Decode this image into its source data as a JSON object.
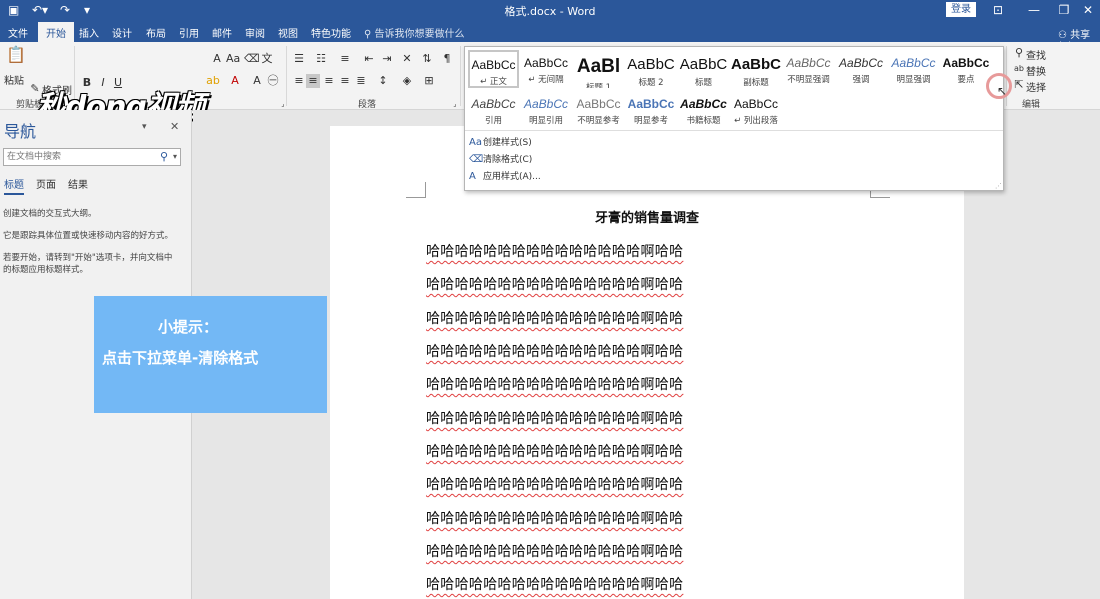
{
  "titlebar": {
    "title": "格式.docx - Word",
    "login_label": "登录",
    "save_icon": "save-icon",
    "undo_icon": "undo-icon",
    "redo_icon": "redo-icon",
    "customize_icon": "customize-icon",
    "ribbon_display_icon": "ribbon-display-icon",
    "minimize_icon": "minimize-icon",
    "restore_icon": "restore-icon",
    "close_icon": "close-icon"
  },
  "tabs": {
    "file": "文件",
    "home": "开始",
    "insert": "插入",
    "design": "设计",
    "layout": "布局",
    "references": "引用",
    "mailings": "邮件",
    "review": "审阅",
    "view": "视图",
    "special": "特色功能",
    "tellme": "告诉我你想要做什么",
    "share": "共享(S)"
  },
  "ribbon": {
    "paste_label": "粘贴",
    "format_painter_label": "格式刷",
    "clipboard_group": "剪贴板",
    "font_group": "字体",
    "paragraph_group": "段落",
    "editing_group": "编辑",
    "find_label": "查找",
    "replace_label": "替换",
    "select_label": "选择",
    "watermark": "秒dong视频"
  },
  "styles_gallery": {
    "row1": [
      {
        "sample": "AaBbCc",
        "name": "↵ 正文",
        "size": "12px",
        "weight": "normal",
        "style": "normal",
        "color": "#111111"
      },
      {
        "sample": "AaBbCc",
        "name": "↵ 无间隔",
        "size": "12px",
        "weight": "normal",
        "style": "normal",
        "color": "#111111"
      },
      {
        "sample": "AaBl",
        "name": "标题 1",
        "size": "19px",
        "weight": "bold",
        "style": "normal",
        "color": "#111111"
      },
      {
        "sample": "AaBbC",
        "name": "标题 2",
        "size": "15px",
        "weight": "normal",
        "style": "normal",
        "color": "#111111"
      },
      {
        "sample": "AaBbC",
        "name": "标题",
        "size": "15px",
        "weight": "normal",
        "style": "normal",
        "color": "#111111"
      },
      {
        "sample": "AaBbC",
        "name": "副标题",
        "size": "15px",
        "weight": "bold",
        "style": "normal",
        "color": "#111111"
      },
      {
        "sample": "AaBbCc",
        "name": "不明显强调",
        "size": "12px",
        "weight": "normal",
        "style": "italic",
        "color": "#666666"
      },
      {
        "sample": "AaBbCc",
        "name": "强调",
        "size": "12px",
        "weight": "normal",
        "style": "italic",
        "color": "#333333"
      },
      {
        "sample": "AaBbCc",
        "name": "明显强调",
        "size": "12px",
        "weight": "normal",
        "style": "italic",
        "color": "#4a74b5"
      },
      {
        "sample": "AaBbCc",
        "name": "要点",
        "size": "12px",
        "weight": "bold",
        "style": "normal",
        "color": "#111111"
      }
    ],
    "row2": [
      {
        "sample": "AaBbCc",
        "name": "引用",
        "size": "12px",
        "weight": "normal",
        "style": "italic",
        "color": "#444444"
      },
      {
        "sample": "AaBbCc",
        "name": "明显引用",
        "size": "12px",
        "weight": "normal",
        "style": "italic",
        "color": "#4a74b5"
      },
      {
        "sample": "AaBbCc",
        "name": "不明显参考",
        "size": "12px",
        "weight": "normal",
        "style": "normal",
        "color": "#777777"
      },
      {
        "sample": "AaBbCc",
        "name": "明显参考",
        "size": "12px",
        "weight": "bold",
        "style": "normal",
        "color": "#4a74b5"
      },
      {
        "sample": "AaBbCc",
        "name": "书籍标题",
        "size": "12px",
        "weight": "bold",
        "style": "italic",
        "color": "#111111"
      },
      {
        "sample": "AaBbCc",
        "name": "↵ 列出段落",
        "size": "12px",
        "weight": "normal",
        "style": "normal",
        "color": "#111111"
      }
    ],
    "actions": {
      "create": "创建样式(S)",
      "clear": "清除格式(C)",
      "apply": "应用样式(A)..."
    }
  },
  "navpane": {
    "title": "导航",
    "search_placeholder": "在文档中搜索",
    "tabs": [
      "标题",
      "页面",
      "结果"
    ],
    "lines": [
      "创建文档的交互式大纲。",
      "它是跟踪具体位置或快速移动内容的好方式。",
      "若要开始，请转到\"开始\"选项卡，并向文档中",
      "的标题应用标题样式。"
    ]
  },
  "tip": {
    "title": "小提示：",
    "body": "点击下拉菜单-清除格式"
  },
  "document": {
    "heading": "牙膏的销售量调查",
    "lines": [
      "哈哈哈哈哈哈哈哈哈哈哈哈哈哈哈啊哈哈",
      "哈哈哈哈哈哈哈哈哈哈哈哈哈哈哈啊哈哈",
      "哈哈哈哈哈哈哈哈哈哈哈哈哈哈哈啊哈哈",
      "哈哈哈哈哈哈哈哈哈哈哈哈哈哈哈啊哈哈",
      "哈哈哈哈哈哈哈哈哈哈哈哈哈哈哈啊哈哈",
      "哈哈哈哈哈哈哈哈哈哈哈哈哈哈哈啊哈哈",
      "哈哈哈哈哈哈哈哈哈哈哈哈哈哈哈啊哈哈",
      "哈哈哈哈哈哈哈哈哈哈哈哈哈哈哈啊哈哈",
      "哈哈哈哈哈哈哈哈哈哈哈哈哈哈哈啊哈哈",
      "哈哈哈哈哈哈哈哈哈哈哈哈哈哈哈啊哈哈",
      "哈哈哈哈哈哈哈哈哈哈哈哈哈哈哈啊哈哈"
    ]
  },
  "colors": {
    "word_blue": "#2b579a",
    "tip_blue": "#73b8f5",
    "spell_red": "#e04040"
  }
}
